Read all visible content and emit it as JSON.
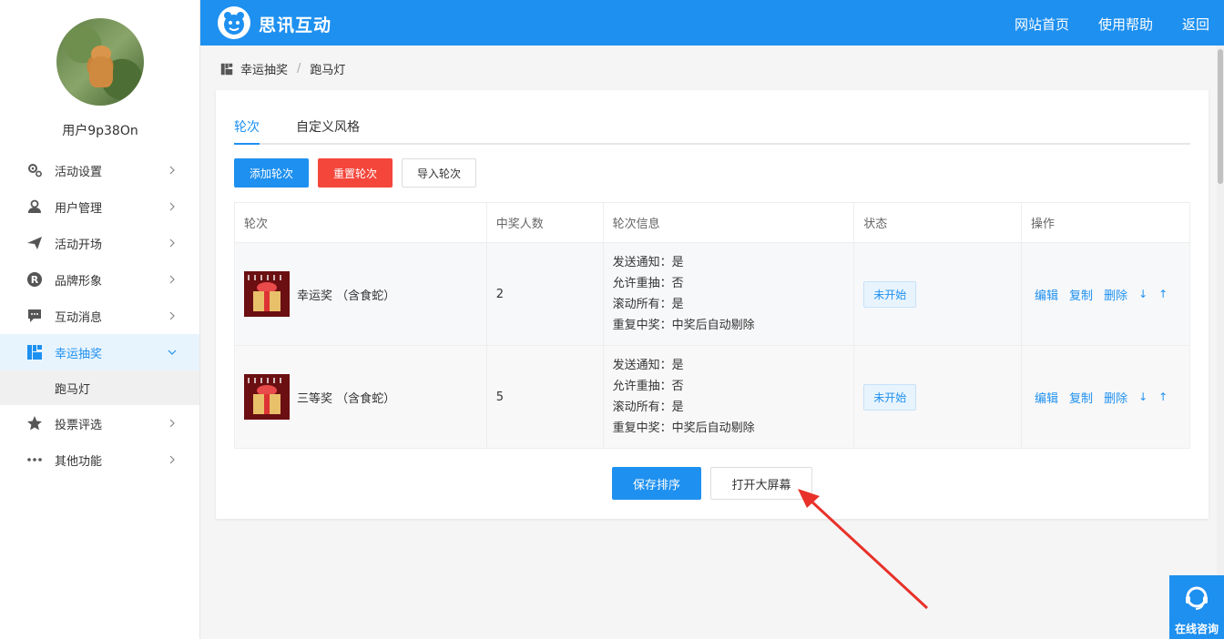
{
  "sidebar": {
    "username": "用户9p38On",
    "menu": [
      {
        "label": "活动设置",
        "icon": "gears-icon"
      },
      {
        "label": "用户管理",
        "icon": "user-icon"
      },
      {
        "label": "活动开场",
        "icon": "paper-plane-icon"
      },
      {
        "label": "品牌形象",
        "icon": "registered-icon"
      },
      {
        "label": "互动消息",
        "icon": "chat-icon"
      },
      {
        "label": "幸运抽奖",
        "icon": "lottery-icon",
        "active": true,
        "sub": [
          "跑马灯"
        ]
      },
      {
        "label": "投票评选",
        "icon": "star-icon"
      },
      {
        "label": "其他功能",
        "icon": "more-icon"
      }
    ]
  },
  "header": {
    "brand": "思讯互动",
    "nav": [
      "网站首页",
      "使用帮助",
      "返回"
    ]
  },
  "breadcrumb": {
    "items": [
      "幸运抽奖",
      "跑马灯"
    ],
    "separator": "/"
  },
  "tabs": [
    "轮次",
    "自定义风格"
  ],
  "buttons": {
    "add": "添加轮次",
    "reset": "重置轮次",
    "import": "导入轮次"
  },
  "table": {
    "headers": [
      "轮次",
      "中奖人数",
      "轮次信息",
      "状态",
      "操作"
    ],
    "rows": [
      {
        "name": "幸运奖 （含食蛇）",
        "winners": "2",
        "info": [
          "发送通知：是",
          "允许重抽：否",
          "滚动所有：是",
          "重复中奖：中奖后自动剔除"
        ],
        "status": "未开始",
        "ops": [
          "编辑",
          "复制",
          "删除"
        ],
        "arrows": [
          "↓",
          "↑"
        ]
      },
      {
        "name": "三等奖 （含食蛇）",
        "winners": "5",
        "info": [
          "发送通知：是",
          "允许重抽：否",
          "滚动所有：是",
          "重复中奖：中奖后自动剔除"
        ],
        "status": "未开始",
        "ops": [
          "编辑",
          "复制",
          "删除"
        ],
        "arrows": [
          "↓",
          "↑"
        ]
      }
    ]
  },
  "bottom": {
    "save": "保存排序",
    "open": "打开大屏幕"
  },
  "consult": {
    "label": "在线咨询"
  },
  "colors": {
    "primary": "#1e90f0",
    "danger": "#f5463b",
    "annotation": "#e8312a"
  }
}
